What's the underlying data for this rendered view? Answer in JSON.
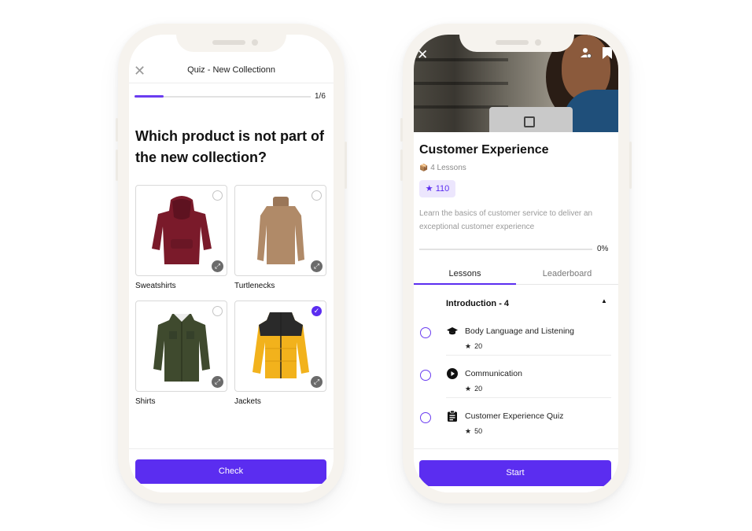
{
  "quiz_screen": {
    "header": {
      "close_icon": "close-icon",
      "title": "Quiz - New Collectionn"
    },
    "progress": {
      "label": "1/6",
      "fraction": 0.167
    },
    "question": "Which product is not part of the new collection?",
    "options": [
      {
        "label": "Sweatshirts",
        "selected": false
      },
      {
        "label": "Turtlenecks",
        "selected": false
      },
      {
        "label": "Shirts",
        "selected": false
      },
      {
        "label": "Jackets",
        "selected": true
      }
    ],
    "check_button": "Check"
  },
  "course_screen": {
    "hero": {
      "close_icon": "close-icon",
      "profile_icon": "user-add-icon",
      "bookmark_icon": "bookmark-icon"
    },
    "title": "Customer Experience",
    "lessons_count": "4 Lessons",
    "points": "110",
    "description": "Learn the basics of customer service to deliver an exceptional customer experience",
    "progress": {
      "label": "0%",
      "fraction": 0
    },
    "tabs": {
      "lessons": "Lessons",
      "leaderboard": "Leaderboard"
    },
    "section": {
      "title": "Introduction - 4"
    },
    "lessons": [
      {
        "title": "Body Language and Listening",
        "points": "20",
        "icon": "graduation-cap-icon"
      },
      {
        "title": "Communication",
        "points": "20",
        "icon": "play-icon"
      },
      {
        "title": "Customer Experience Quiz",
        "points": "50",
        "icon": "clipboard-icon"
      }
    ],
    "start_button": "Start"
  },
  "colors": {
    "accent": "#5b2df0",
    "badge_bg": "#ece6fd"
  }
}
